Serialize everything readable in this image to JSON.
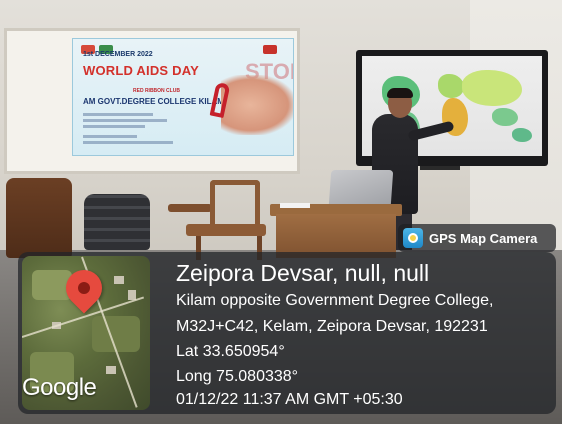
{
  "banner": {
    "date": "1st DECEMBER 2022",
    "title": "WORLD AIDS DAY",
    "club": "RED RIBBON CLUB",
    "college": "AM GOVT.DEGREE COLLEGE KILAM"
  },
  "gps_badge": {
    "label": "GPS Map Camera",
    "icon": "camera-icon"
  },
  "map": {
    "pin_icon": "map-pin-icon",
    "logo_text": "Google"
  },
  "location": {
    "title": "Zeipora Devsar, null, null",
    "address_line_1": "Kilam opposite Government Degree College,",
    "address_line_2": "M32J+C42, Kelam, Zeipora Devsar, 192231",
    "latitude": "Lat 33.650954°",
    "longitude": "Long 75.080338°",
    "datetime": "01/12/22 11:37 AM GMT +05:30"
  },
  "colors": {
    "pin": "#e64a3e",
    "overlay": "#222428",
    "overlay_text": "#ffffff"
  }
}
